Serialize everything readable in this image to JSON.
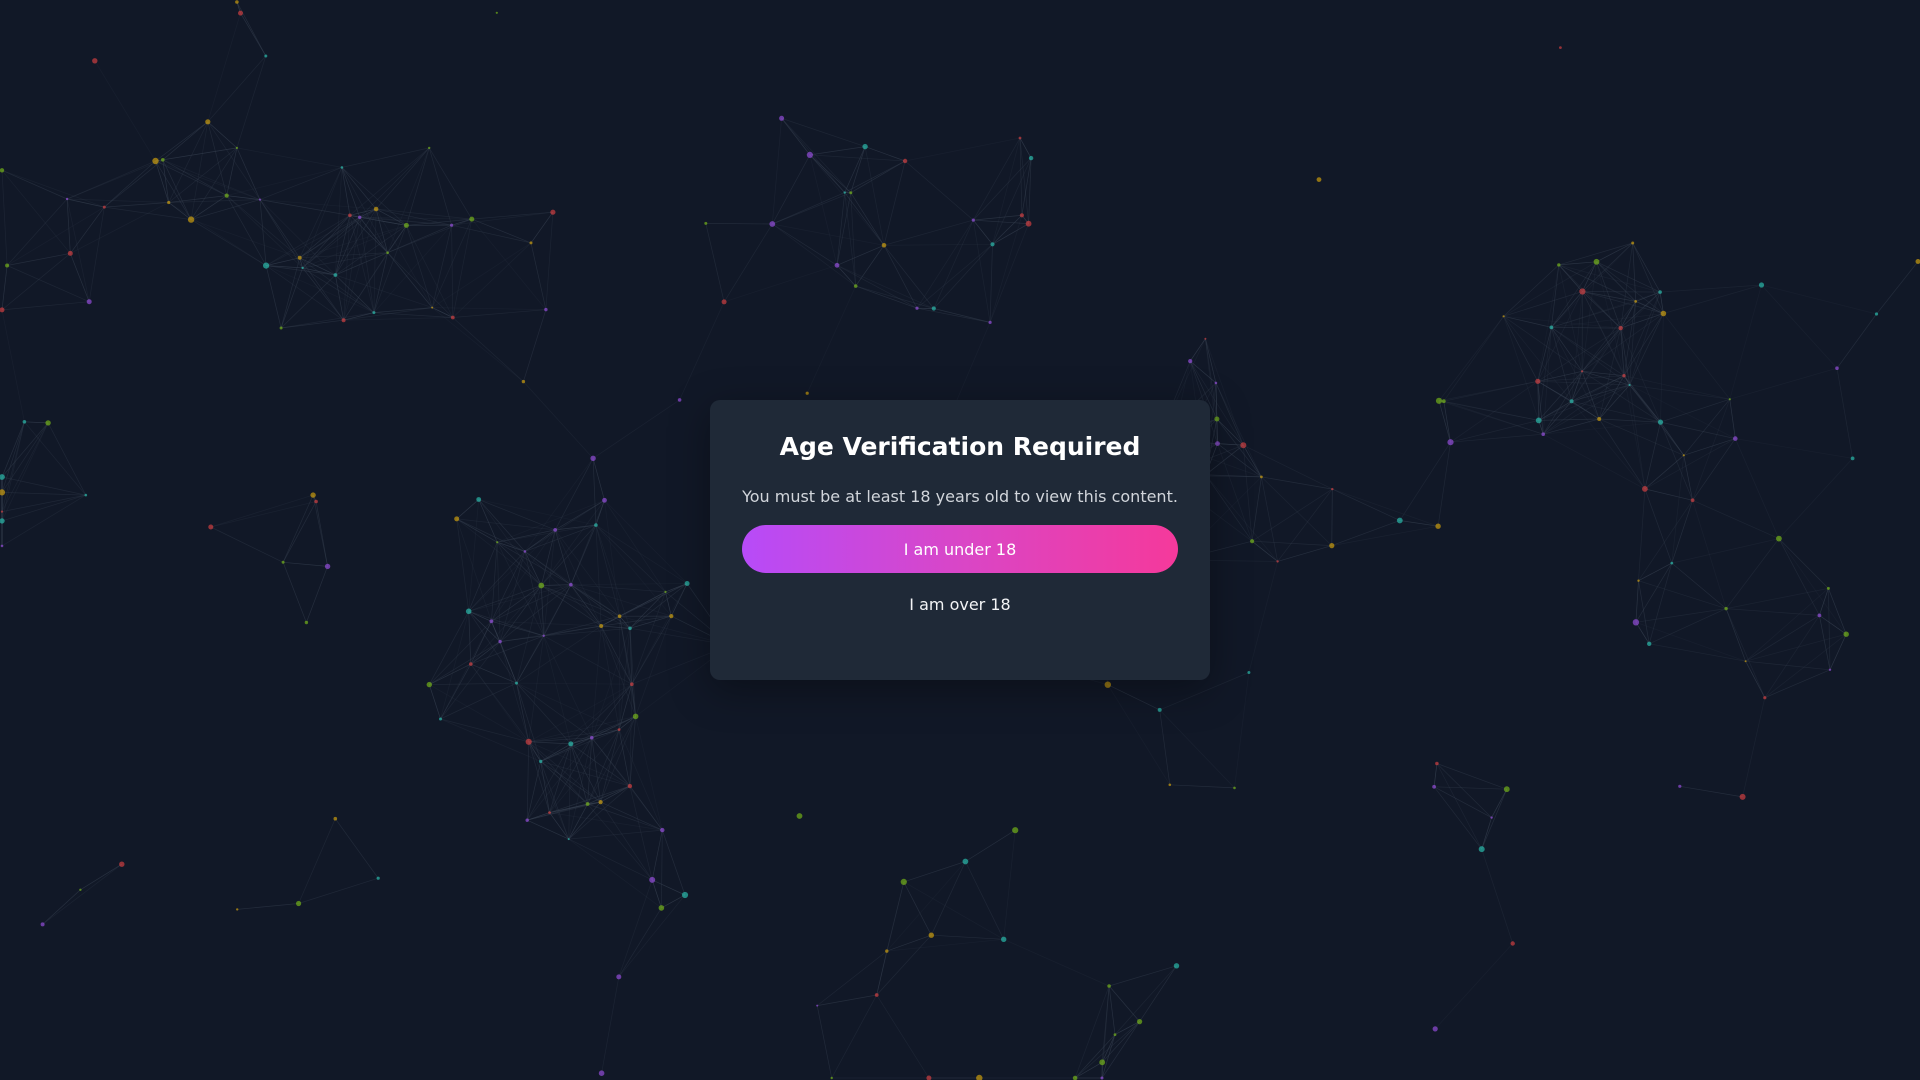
{
  "age_gate": {
    "title": "Age Verification Required",
    "message": "You must be at least 18 years old to view this content.",
    "under_label": "I am under 18",
    "over_label": "I am over 18"
  },
  "background": {
    "color": "#111827",
    "node_colors": [
      "#2dd4bf",
      "#eab308",
      "#a855f7",
      "#ef4444",
      "#84cc16"
    ],
    "line_color": "#374151"
  }
}
